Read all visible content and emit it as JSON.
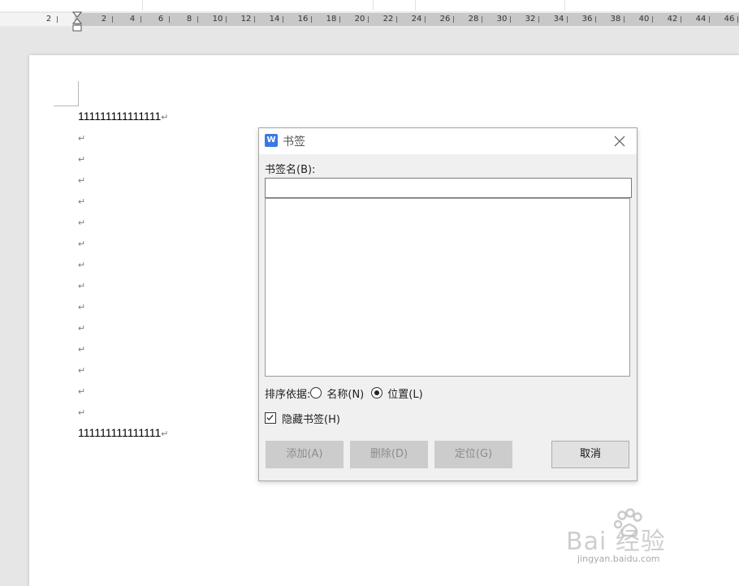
{
  "ruler": {
    "labels": [
      "2",
      "2",
      "4",
      "6",
      "8",
      "10",
      "12",
      "14",
      "16",
      "18",
      "20",
      "22",
      "24",
      "26",
      "28",
      "30",
      "32",
      "34",
      "36",
      "38",
      "40",
      "42",
      "44",
      "46"
    ]
  },
  "document": {
    "lines": [
      {
        "text": "111111111111111"
      },
      {
        "text": ""
      },
      {
        "text": ""
      },
      {
        "text": ""
      },
      {
        "text": ""
      },
      {
        "text": ""
      },
      {
        "text": ""
      },
      {
        "text": ""
      },
      {
        "text": ""
      },
      {
        "text": ""
      },
      {
        "text": ""
      },
      {
        "text": ""
      },
      {
        "text": ""
      },
      {
        "text": ""
      },
      {
        "text": ""
      },
      {
        "text": "111111111111111"
      }
    ],
    "paragraph_mark": "↵"
  },
  "dialog": {
    "title": "书签",
    "app_icon": "W",
    "name_label": "书签名(B):",
    "name_value": "",
    "sort_label": "排序依据:",
    "sort_options": [
      {
        "label": "名称(N)",
        "checked": false
      },
      {
        "label": "位置(L)",
        "checked": true
      }
    ],
    "hide_label": "隐藏书签(H)",
    "hide_checked": true,
    "buttons": {
      "add": "添加(A)",
      "delete": "删除(D)",
      "goto": "定位(G)",
      "cancel": "取消"
    }
  },
  "watermark": {
    "text": "Bai 经验",
    "sub": "jingyan.baidu.com"
  },
  "icons": [
    "app-icon",
    "close-icon",
    "checkmark-icon",
    "paw-icon"
  ],
  "colors": {
    "accent": "#3a7ae0"
  }
}
